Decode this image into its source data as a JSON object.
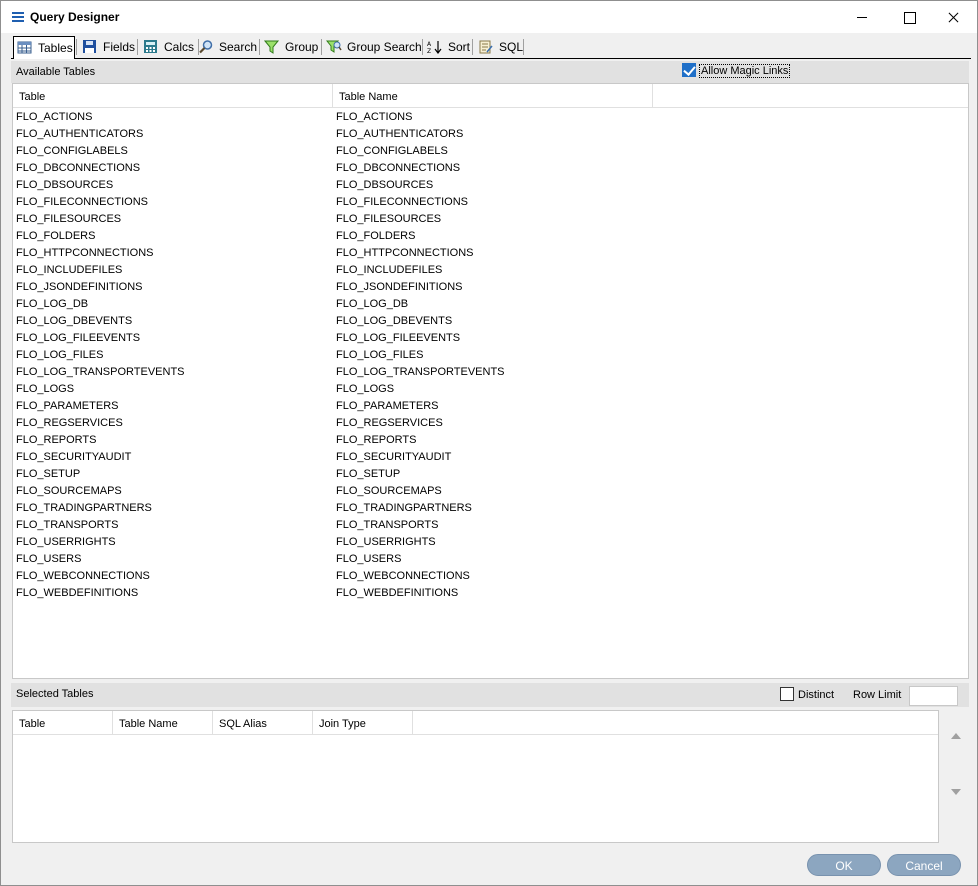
{
  "window": {
    "title": "Query Designer"
  },
  "toolbar": {
    "items": [
      {
        "label": "Tables",
        "icon": "table-icon"
      },
      {
        "label": "Fields",
        "icon": "save-icon"
      },
      {
        "label": "Calcs",
        "icon": "calculator-icon"
      },
      {
        "label": "Search",
        "icon": "magnifier-icon"
      },
      {
        "label": "Group",
        "icon": "filter-icon"
      },
      {
        "label": "Group Search",
        "icon": "filter-search-icon"
      },
      {
        "label": "Sort",
        "icon": "sort-az-icon"
      },
      {
        "label": "SQL",
        "icon": "script-icon"
      }
    ]
  },
  "available": {
    "label": "Available Tables",
    "magic_links_label": "Allow Magic Links",
    "magic_links_checked": true,
    "columns": [
      "Table",
      "Table Name"
    ],
    "rows": [
      [
        "FLO_ACTIONS",
        "FLO_ACTIONS"
      ],
      [
        "FLO_AUTHENTICATORS",
        "FLO_AUTHENTICATORS"
      ],
      [
        "FLO_CONFIGLABELS",
        "FLO_CONFIGLABELS"
      ],
      [
        "FLO_DBCONNECTIONS",
        "FLO_DBCONNECTIONS"
      ],
      [
        "FLO_DBSOURCES",
        "FLO_DBSOURCES"
      ],
      [
        "FLO_FILECONNECTIONS",
        "FLO_FILECONNECTIONS"
      ],
      [
        "FLO_FILESOURCES",
        "FLO_FILESOURCES"
      ],
      [
        "FLO_FOLDERS",
        "FLO_FOLDERS"
      ],
      [
        "FLO_HTTPCONNECTIONS",
        "FLO_HTTPCONNECTIONS"
      ],
      [
        "FLO_INCLUDEFILES",
        "FLO_INCLUDEFILES"
      ],
      [
        "FLO_JSONDEFINITIONS",
        "FLO_JSONDEFINITIONS"
      ],
      [
        "FLO_LOG_DB",
        "FLO_LOG_DB"
      ],
      [
        "FLO_LOG_DBEVENTS",
        "FLO_LOG_DBEVENTS"
      ],
      [
        "FLO_LOG_FILEEVENTS",
        "FLO_LOG_FILEEVENTS"
      ],
      [
        "FLO_LOG_FILES",
        "FLO_LOG_FILES"
      ],
      [
        "FLO_LOG_TRANSPORTEVENTS",
        "FLO_LOG_TRANSPORTEVENTS"
      ],
      [
        "FLO_LOGS",
        "FLO_LOGS"
      ],
      [
        "FLO_PARAMETERS",
        "FLO_PARAMETERS"
      ],
      [
        "FLO_REGSERVICES",
        "FLO_REGSERVICES"
      ],
      [
        "FLO_REPORTS",
        "FLO_REPORTS"
      ],
      [
        "FLO_SECURITYAUDIT",
        "FLO_SECURITYAUDIT"
      ],
      [
        "FLO_SETUP",
        "FLO_SETUP"
      ],
      [
        "FLO_SOURCEMAPS",
        "FLO_SOURCEMAPS"
      ],
      [
        "FLO_TRADINGPARTNERS",
        "FLO_TRADINGPARTNERS"
      ],
      [
        "FLO_TRANSPORTS",
        "FLO_TRANSPORTS"
      ],
      [
        "FLO_USERRIGHTS",
        "FLO_USERRIGHTS"
      ],
      [
        "FLO_USERS",
        "FLO_USERS"
      ],
      [
        "FLO_WEBCONNECTIONS",
        "FLO_WEBCONNECTIONS"
      ],
      [
        "FLO_WEBDEFINITIONS",
        "FLO_WEBDEFINITIONS"
      ]
    ]
  },
  "selected": {
    "label": "Selected Tables",
    "distinct_label": "Distinct",
    "distinct_checked": false,
    "row_limit_label": "Row Limit",
    "row_limit_value": "",
    "columns": [
      "Table",
      "Table Name",
      "SQL Alias",
      "Join Type"
    ]
  },
  "buttons": {
    "ok": "OK",
    "cancel": "Cancel"
  }
}
